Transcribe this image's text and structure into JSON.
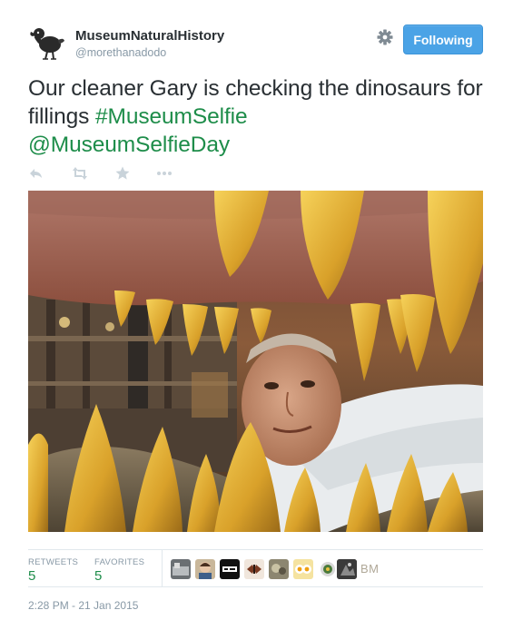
{
  "header": {
    "display_name": "MuseumNaturalHistory",
    "handle": "@morethanadodo",
    "avatar_icon": "dodo-icon",
    "settings_icon": "gear-icon",
    "follow_label": "Following"
  },
  "tweet": {
    "text_plain": "Our cleaner Gary is checking the dinosaurs for fillings ",
    "hashtag": "#MuseumSelfie",
    "mention": "@MuseumSelfieDay",
    "hashtag_color": "#1e8d4a"
  },
  "actions": {
    "icons": [
      "reply-icon",
      "retweet-icon",
      "favorite-icon",
      "more-icon"
    ]
  },
  "photo": {
    "subject": "dinosaur-jaw-selfie"
  },
  "stats": {
    "retweets_label": "RETWEETS",
    "retweets_count": "5",
    "favorites_label": "FAVORITES",
    "favorites_count": "5",
    "last_favoriter_initials": "BM"
  },
  "timestamp": "2:28 PM - 21 Jan 2015",
  "colors": {
    "follow_button": "#4ba3e6",
    "link": "#1e8d4a",
    "muted": "#8899a6"
  }
}
